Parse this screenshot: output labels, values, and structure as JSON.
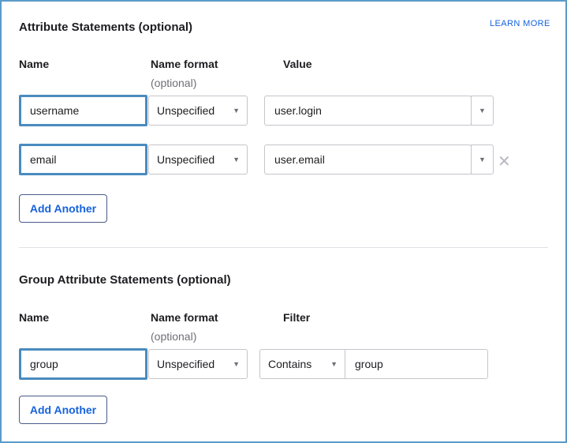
{
  "attribute_statements": {
    "title": "Attribute Statements (optional)",
    "learn_more": "LEARN MORE",
    "columns": {
      "name": "Name",
      "name_format": "Name format",
      "name_format_sub": "(optional)",
      "value": "Value"
    },
    "rows": [
      {
        "name": "username",
        "format": "Unspecified",
        "value": "user.login"
      },
      {
        "name": "email",
        "format": "Unspecified",
        "value": "user.email"
      }
    ],
    "add_another": "Add Another"
  },
  "group_attribute_statements": {
    "title": "Group Attribute Statements (optional)",
    "columns": {
      "name": "Name",
      "name_format": "Name format",
      "name_format_sub": "(optional)",
      "filter": "Filter"
    },
    "rows": [
      {
        "name": "group",
        "format": "Unspecified",
        "filter_type": "Contains",
        "filter_value": "group"
      }
    ],
    "add_another": "Add Another"
  },
  "icons": {
    "caret": "▼",
    "remove": "✕"
  },
  "colors": {
    "accent": "#1662dd",
    "focus_border": "#4a8bbf",
    "frame_border": "#5b9bc9"
  }
}
